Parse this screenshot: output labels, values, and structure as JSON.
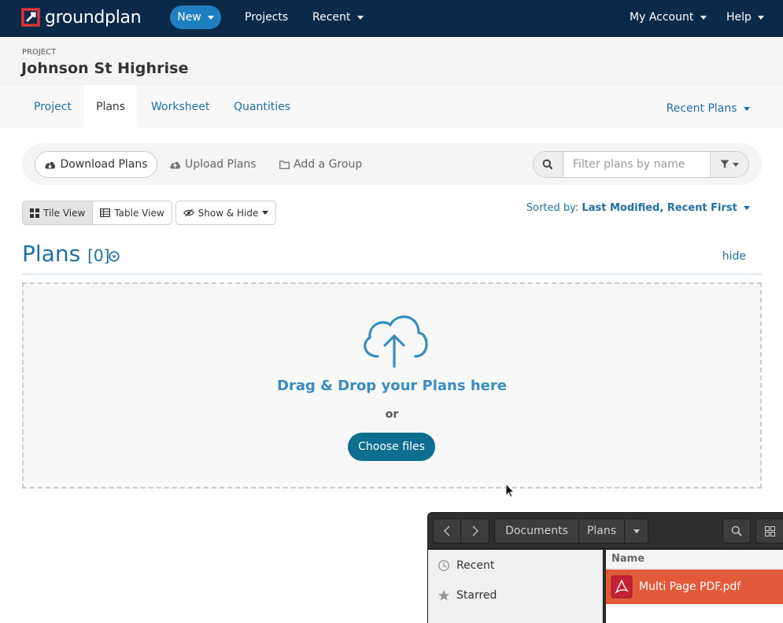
{
  "topnav": {
    "logo_text": "groundplan",
    "new_label": "New",
    "projects_label": "Projects",
    "recent_label": "Recent",
    "account_label": "My Account",
    "help_label": "Help"
  },
  "project": {
    "label": "PROJECT",
    "title": "Johnson St Highrise"
  },
  "tabs": [
    {
      "label": "Project",
      "active": false
    },
    {
      "label": "Plans",
      "active": true
    },
    {
      "label": "Worksheet",
      "active": false
    },
    {
      "label": "Quantities",
      "active": false
    }
  ],
  "recent_plans_label": "Recent Plans",
  "toolbar": {
    "download_label": "Download Plans",
    "upload_label": "Upload Plans",
    "add_group_label": "Add a Group",
    "filter_placeholder": "Filter plans by name"
  },
  "view": {
    "tile_label": "Tile View",
    "table_label": "Table View",
    "show_hide_label": "Show & Hide",
    "sorted_prefix": "Sorted by:",
    "sorted_value": "Last Modified, Recent First"
  },
  "plans": {
    "title": "Plans",
    "count": "[0]",
    "hide_label": "hide"
  },
  "dropzone": {
    "title": "Drag & Drop your Plans here",
    "or": "or",
    "choose_label": "Choose files"
  },
  "dialog": {
    "path": [
      "Documents",
      "Plans"
    ],
    "sidebar": [
      "Recent",
      "Starred"
    ],
    "column_name": "Name",
    "selected_file": "Multi Page PDF.pdf"
  },
  "colors": {
    "nav_bg": "#0b2a4a",
    "accent": "#1f6fa6",
    "new_button": "#1f7fc0",
    "choose_button": "#0d6e8f",
    "logo_red": "#e0323c",
    "file_selected": "#e25a3a"
  }
}
